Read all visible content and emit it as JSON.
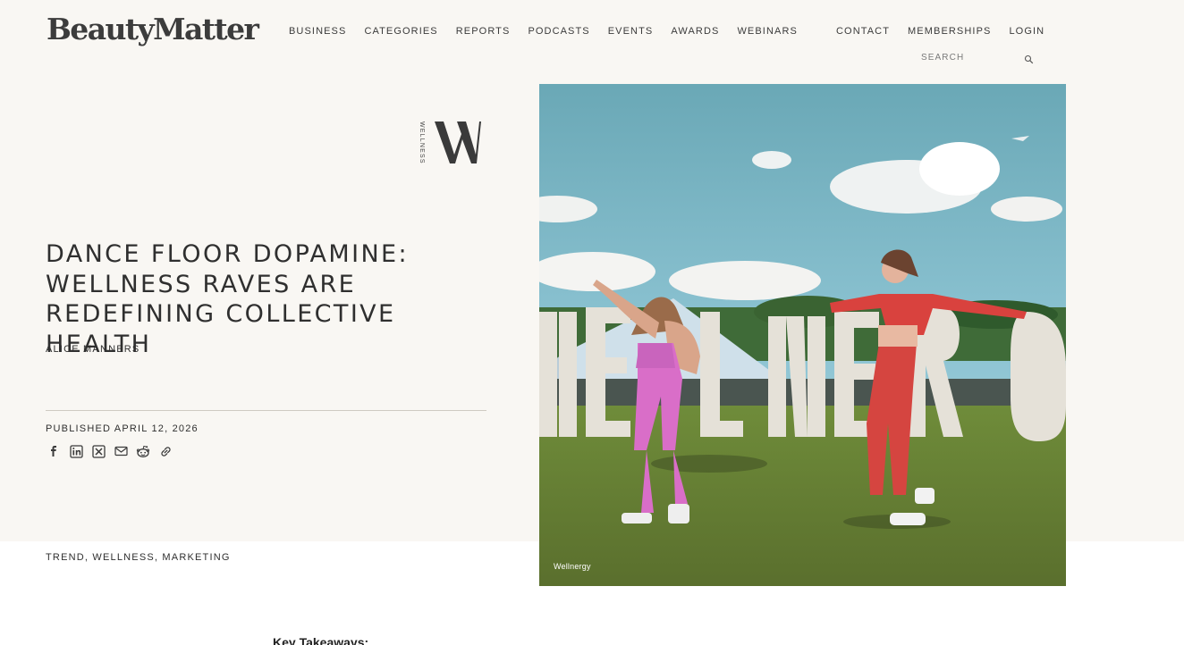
{
  "brand": {
    "logo_text": "BeautyMatter"
  },
  "nav": {
    "items": [
      "BUSINESS",
      "CATEGORIES",
      "REPORTS",
      "PODCASTS",
      "EVENTS",
      "AWARDS",
      "WEBINARS"
    ],
    "right_items": [
      "CONTACT",
      "MEMBERSHIPS",
      "LOGIN"
    ],
    "search_placeholder": "SEARCH"
  },
  "article": {
    "category_vertical": "WELLNESS",
    "category_letter": "W",
    "title": "DANCE FLOOR DOPAMINE: WELLNESS RAVES ARE REDEFINING COLLECTIVE HEALTH",
    "author": "ALICE MANNERS",
    "published": "PUBLISHED APRIL 12, 2026",
    "tags": "TREND, WELLNESS, MARKETING",
    "image_credit": "Wellnergy",
    "image_sign_letters": "VELLNERG",
    "key_takeaways_heading": "Key Takeaways:"
  },
  "share_icons": [
    "facebook-icon",
    "linkedin-icon",
    "x-icon",
    "email-icon",
    "reddit-icon",
    "link-icon"
  ],
  "colors": {
    "hero_bg": "#f9f7f3",
    "text": "#2f2f2f",
    "divider": "#cfcac2"
  }
}
